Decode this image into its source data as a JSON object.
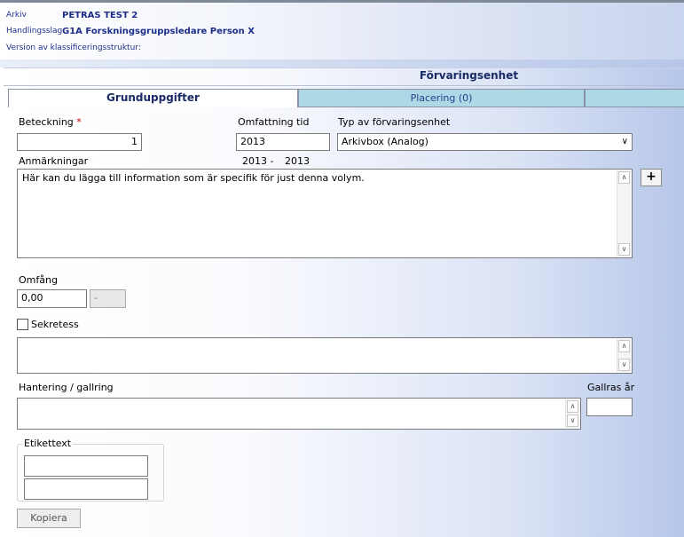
{
  "header": {
    "arkiv_label": "Arkiv",
    "arkiv_value": "PETRAS TEST 2",
    "handlingsslag_label": "Handlingsslag",
    "handlingsslag_value": "G1A  Forskningsgruppsledare Person X",
    "version_label": "Version av klassificeringsstruktur:"
  },
  "panel": {
    "title": "Förvaringsenhet"
  },
  "tabs": [
    {
      "label": "Grunduppgifter",
      "active": true
    },
    {
      "label": "Placering (0)",
      "active": false
    }
  ],
  "form": {
    "beteckning_label": "Beteckning",
    "required_mark": "*",
    "beteckning_value": "1",
    "omfattning_label": "Omfattning tid",
    "omfattning_value": "2013",
    "omfattning_range_from": "2013 -",
    "omfattning_range_to": "2013",
    "typ_label": "Typ av förvaringsenhet",
    "typ_value": "Arkivbox  (Analog)",
    "anmarkningar_label": "Anmärkningar",
    "anmarkningar_value": "Här kan du lägga till information som är specifik för just denna volym.",
    "add_button": "+",
    "omfang_label": "Omfång",
    "omfang_value": "0,00",
    "omfang_unit": "-",
    "sekretess_label": "Sekretess",
    "sekretess_checked": false,
    "sekretess_text": "",
    "hantering_label": "Hantering / gallring",
    "hantering_value": "",
    "gallras_label": "Gallras år",
    "gallras_value": "",
    "etikettext_label": "Etikettext",
    "etikettext_line1": "",
    "etikettext_line2": "",
    "kopiera_button": "Kopiera"
  },
  "icons": {
    "select": "chevron-down-icon",
    "scroll_up": "scroll-up-icon",
    "scroll_down": "scroll-down-icon"
  }
}
